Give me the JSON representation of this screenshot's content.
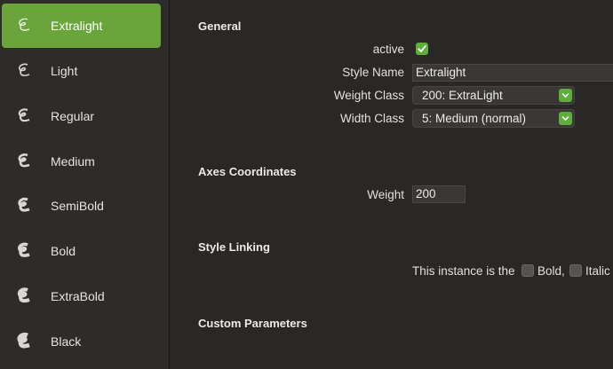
{
  "sidebar": {
    "items": [
      {
        "label": "Extralight",
        "selected": true
      },
      {
        "label": "Light"
      },
      {
        "label": "Regular"
      },
      {
        "label": "Medium"
      },
      {
        "label": "SemiBold"
      },
      {
        "label": "Bold"
      },
      {
        "label": "ExtraBold"
      },
      {
        "label": "Black"
      }
    ],
    "icon": "font-instance-icon"
  },
  "general": {
    "title": "General",
    "active_label": "active",
    "active_checked": true,
    "style_name_label": "Style Name",
    "style_name_value": "Extralight",
    "weight_class_label": "Weight Class",
    "weight_class_value": "200: ExtraLight",
    "width_class_label": "Width Class",
    "width_class_value": "5: Medium (normal)"
  },
  "axes": {
    "title": "Axes Coordinates",
    "weight_label": "Weight",
    "weight_value": "200"
  },
  "style_linking": {
    "title": "Style Linking",
    "prefix": "This instance is the",
    "bold_label": "Bold,",
    "italic_label": "Italic"
  },
  "custom_parameters": {
    "title": "Custom Parameters"
  },
  "colors": {
    "accent": "#6aa43a",
    "background": "#2a2826",
    "sidebar": "#2e2c2a"
  }
}
